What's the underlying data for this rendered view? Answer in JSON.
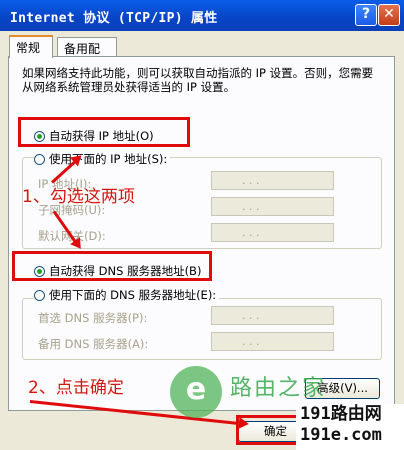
{
  "window": {
    "title": "Internet 协议 (TCP/IP) 属性",
    "help_label": "?",
    "close_label": "✕"
  },
  "tabs": [
    {
      "label": "常规",
      "active": true
    },
    {
      "label": "备用配置",
      "active": false
    }
  ],
  "description": "如果网络支持此功能，则可以获取自动指派的 IP 设置。否则，您需要从网络系统管理员处获得适当的 IP 设置。",
  "ip_section": {
    "auto_option": {
      "label": "自动获得 IP 地址(O)",
      "checked": true
    },
    "manual_option": {
      "label": "使用下面的 IP 地址(S):",
      "checked": false
    },
    "fields": [
      {
        "label": "IP 地址(I):",
        "value": ". . ."
      },
      {
        "label": "子网掩码(U):",
        "value": ". . ."
      },
      {
        "label": "默认网关(D):",
        "value": ". . ."
      }
    ]
  },
  "dns_section": {
    "auto_option": {
      "label": "自动获得 DNS 服务器地址(B)",
      "checked": true
    },
    "manual_option": {
      "label": "使用下面的 DNS 服务器地址(E):",
      "checked": false
    },
    "fields": [
      {
        "label": "首选 DNS 服务器(P):",
        "value": ". . ."
      },
      {
        "label": "备用 DNS 服务器(A):",
        "value": ". . ."
      }
    ]
  },
  "buttons": {
    "advanced": "高级(V)...",
    "ok": "确定"
  },
  "annotations": {
    "step1": "1、勾选这两项",
    "step2": "2、点击确定"
  },
  "watermark": {
    "logo_glyph": "e",
    "text": "路由之家",
    "site_line1": "191路由网",
    "site_line2": "191e.com"
  },
  "colors": {
    "title_bar": "#0745c7",
    "annotation_red": "#e00c0c",
    "radio_dot": "#21a121"
  }
}
